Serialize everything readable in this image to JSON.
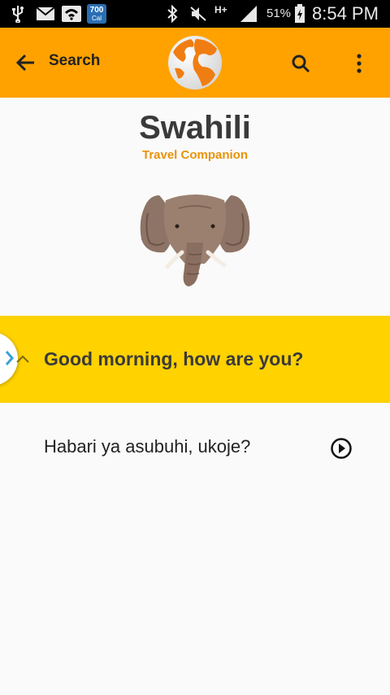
{
  "status_bar": {
    "calendar_badge_top": "700",
    "calendar_badge_bottom": "Cal",
    "network_type": "H+",
    "battery_percent": "51%",
    "time": "8:54 PM",
    "icons": [
      "usb-icon",
      "mail-icon",
      "wifi-icon",
      "calendar-badge-icon",
      "bluetooth-icon",
      "mute-icon",
      "signal-icon",
      "battery-icon"
    ]
  },
  "app_bar": {
    "back_label": "Search",
    "colors": {
      "bar": "#ffa200"
    }
  },
  "header": {
    "title": "Swahili",
    "subtitle": "Travel Companion"
  },
  "phrase": {
    "english": "Good morning, how are you?",
    "swahili": "Habari ya asubuhi, ukoje?",
    "band_color": "#ffd200"
  }
}
